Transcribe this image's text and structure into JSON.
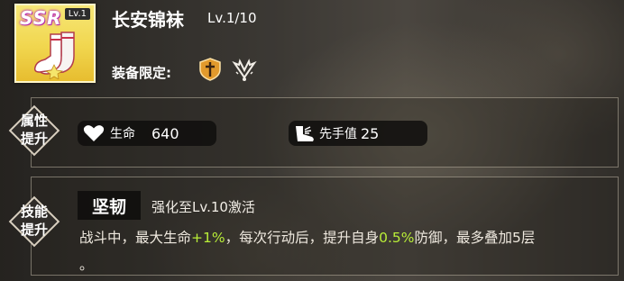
{
  "item": {
    "rarity": "SSR",
    "card_level": "Lv.1",
    "name": "长安锦袜",
    "level": "Lv.1/10",
    "icon": "sock-icon"
  },
  "equip": {
    "label": "装备限定:",
    "class_icons": [
      "dagger-shield-icon",
      "wing-sparkle-icon"
    ]
  },
  "attributes": {
    "section_label": [
      "属性",
      "提升"
    ],
    "stats": [
      {
        "icon": "heart-icon",
        "name": "生命",
        "value": "640"
      },
      {
        "icon": "winged-boot-icon",
        "name": "先手值",
        "value": "25"
      }
    ]
  },
  "skill": {
    "section_label": [
      "技能",
      "提升"
    ],
    "name": "坚韧",
    "unlock": "强化至Lv.10激活",
    "desc": {
      "p1": "战斗中，最大生命",
      "v1": "+1%",
      "p2": "，每次行动后，提升自身",
      "v2": "0.5%",
      "p3": "防御，最多叠加5层",
      "p4": "。"
    }
  },
  "colors": {
    "card_gold": "#f1d64e",
    "highlight_green": "#b9ee38",
    "pill_bg": "#0f0e0d"
  }
}
